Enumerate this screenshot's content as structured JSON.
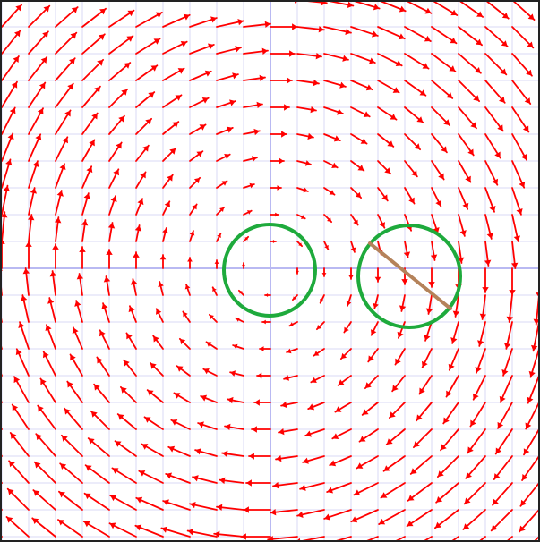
{
  "colors": {
    "background": "#ffffff",
    "grid": "#d8d8f4",
    "axis": "#b9b9f2",
    "arrow": "#ff0000",
    "circle": "#1eaa3c",
    "segment": "#b4825a",
    "border": "#222222"
  },
  "field": {
    "kind": "rotational vector field (clockwise) on a square grid",
    "grid_lines": true,
    "axes": true,
    "arrow_direction": "clockwise"
  },
  "annotations": {
    "circles": 2,
    "segments": 1
  }
}
